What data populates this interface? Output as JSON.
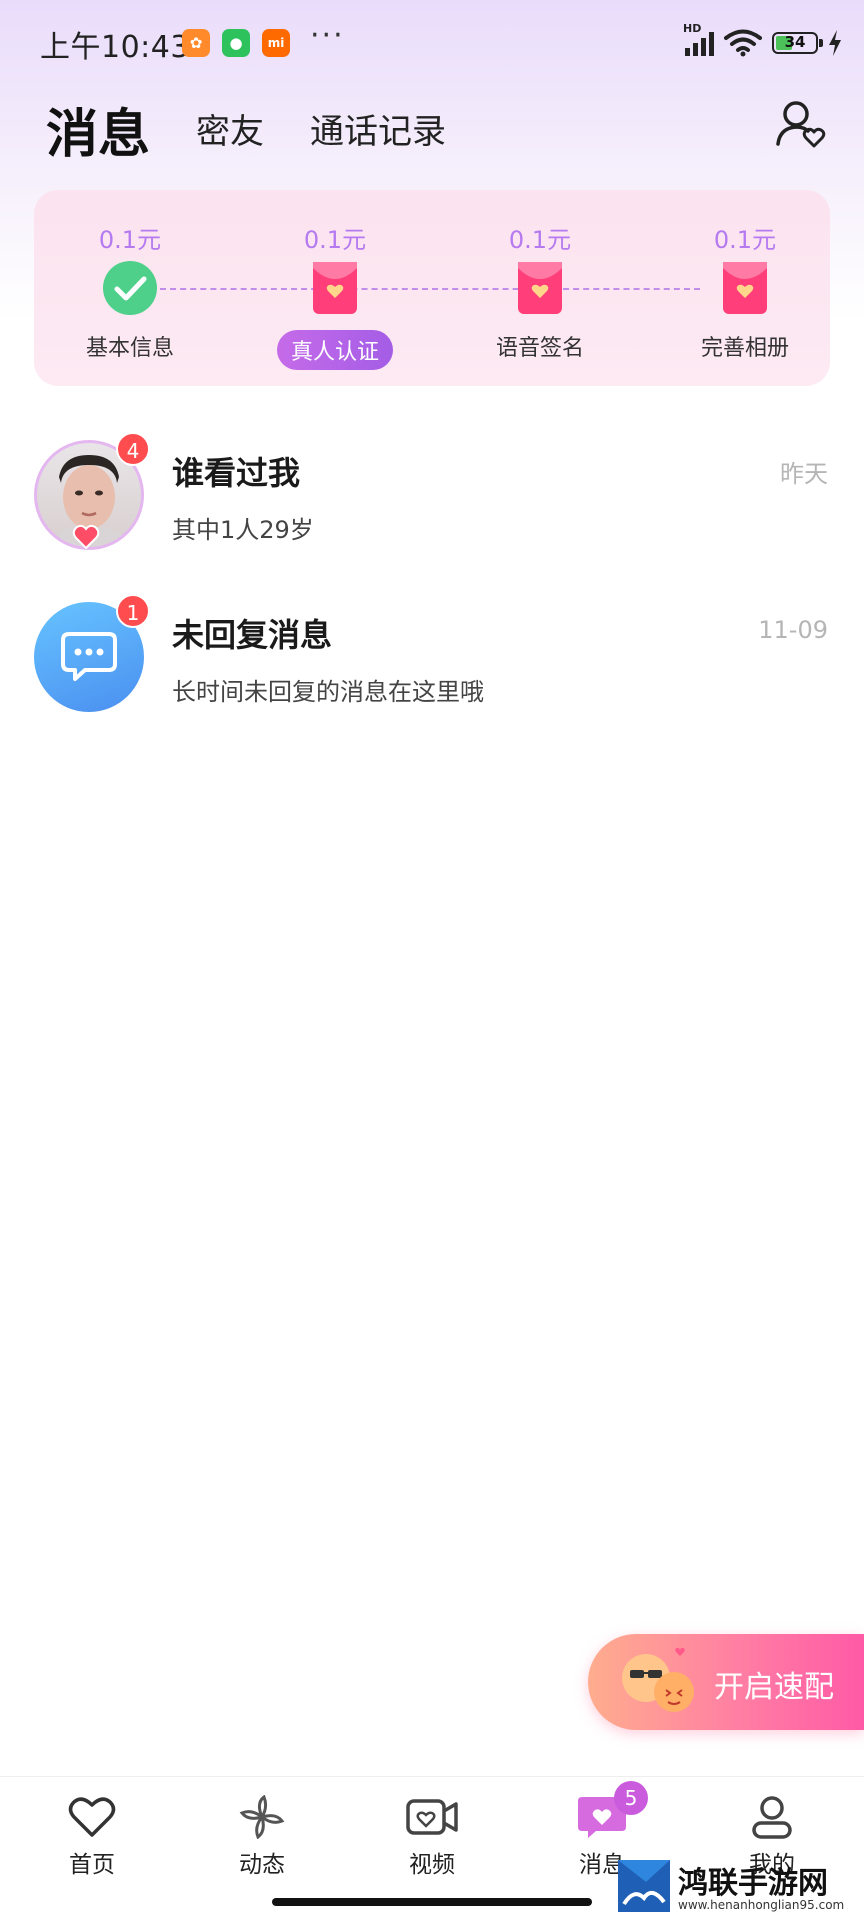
{
  "status_bar": {
    "time": "上午10:43",
    "battery": "34",
    "network": "HD"
  },
  "header": {
    "tabs": [
      {
        "label": "消息",
        "active": true
      },
      {
        "label": "密友",
        "active": false
      },
      {
        "label": "通话记录",
        "active": false
      }
    ]
  },
  "tasks": {
    "items": [
      {
        "reward": "0.1元",
        "label": "基本信息",
        "status": "done",
        "icon": "check-icon"
      },
      {
        "reward": "0.1元",
        "label": "真人认证",
        "status": "active",
        "icon": "red-envelope-icon"
      },
      {
        "reward": "0.1元",
        "label": "语音签名",
        "status": "pending",
        "icon": "red-envelope-icon"
      },
      {
        "reward": "0.1元",
        "label": "完善相册",
        "status": "pending",
        "icon": "red-envelope-icon"
      }
    ]
  },
  "list": {
    "items": [
      {
        "title": "谁看过我",
        "subtitle": "其中1人29岁",
        "time": "昨天",
        "badge": "4",
        "avatar": "user-photo"
      },
      {
        "title": "未回复消息",
        "subtitle": "长时间未回复的消息在这里哦",
        "time": "11-09",
        "badge": "1",
        "avatar": "chat-bubble-icon"
      }
    ]
  },
  "quick_match": {
    "label": "开启速配"
  },
  "bottom_nav": {
    "items": [
      {
        "label": "首页",
        "icon": "heart-icon"
      },
      {
        "label": "动态",
        "icon": "pinwheel-icon"
      },
      {
        "label": "视频",
        "icon": "video-icon"
      },
      {
        "label": "消息",
        "icon": "message-heart-icon",
        "badge": "5",
        "active": true
      },
      {
        "label": "我的",
        "icon": "person-icon"
      }
    ]
  },
  "watermark": {
    "title": "鸿联手游网",
    "url": "www.henanhonglian95.com"
  },
  "colors": {
    "accent": "#b57af0",
    "badge": "#ff4d4f",
    "active_pill": "#c56be9"
  }
}
